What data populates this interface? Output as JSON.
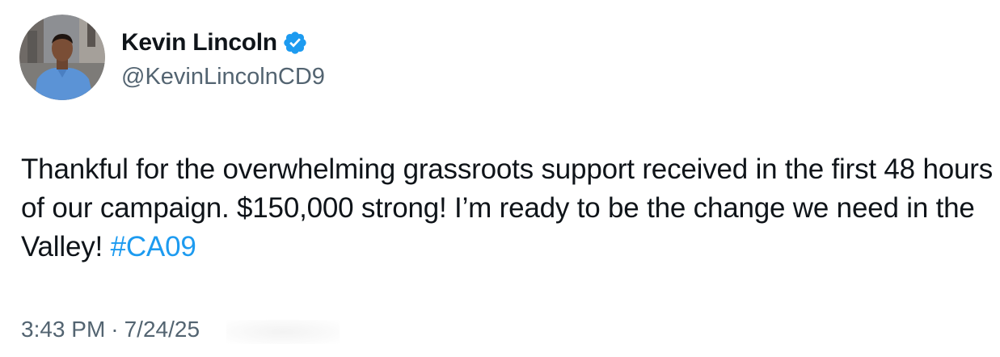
{
  "author": {
    "display_name": "Kevin Lincoln",
    "handle": "@KevinLincolnCD9",
    "verified_icon": "verified-badge-icon",
    "avatar_icon": "profile-photo"
  },
  "tweet": {
    "text_main": "Thankful for the overwhelming grassroots support received in the first 48 hours of our campaign. $150,000 strong! I’m ready to be the change we need in the Valley! ",
    "hashtag": "#CA09",
    "time": "3:43 PM",
    "separator": "·",
    "date": "7/24/25"
  },
  "colors": {
    "text": "#0f1419",
    "secondary": "#536471",
    "accent": "#1d9bf0"
  }
}
